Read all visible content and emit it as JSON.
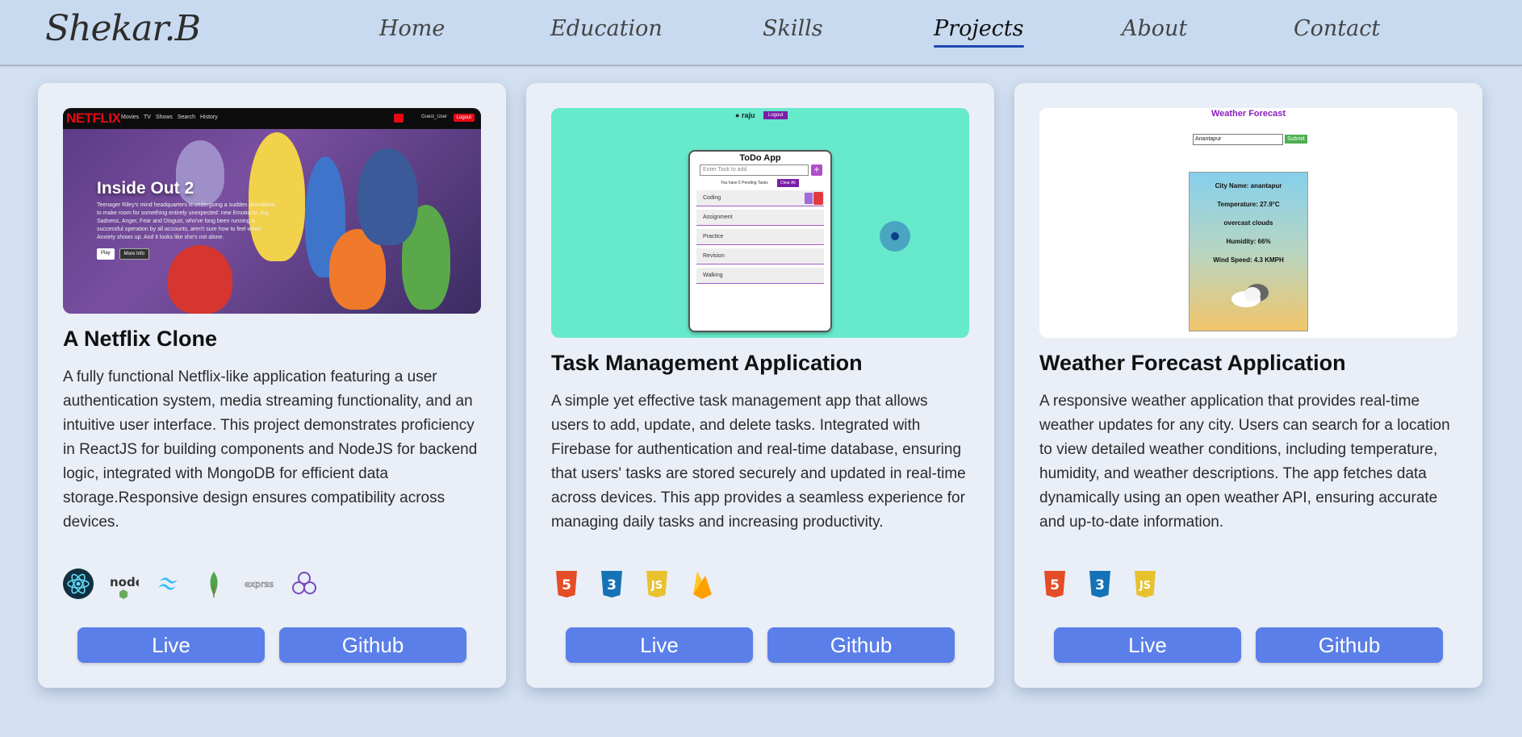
{
  "nav": {
    "brand": "Shekar.B",
    "links": [
      "Home",
      "Education",
      "Skills",
      "Projects",
      "About",
      "Contact"
    ],
    "active": "Projects"
  },
  "projects": [
    {
      "title": "A Netflix Clone",
      "description": "A fully functional Netflix-like application featuring a user authentication system, media streaming functionality, and an intuitive user interface. This project demonstrates proficiency in ReactJS for building components and NodeJS for backend logic, integrated with MongoDB for efficient data storage.Responsive design ensures compatibility across devices.",
      "tech_icons": [
        "react-icon",
        "nodejs-icon",
        "tailwind-icon",
        "mongodb-icon",
        "express-icon",
        "redux-icon"
      ],
      "live_label": "Live",
      "github_label": "Github",
      "screenshot": {
        "logo": "NETFLIX",
        "menu": "Movies TV Shows Search History",
        "user": "Guest_User",
        "logout": "Logout",
        "hero_title": "Inside Out 2",
        "hero_desc": "Teenager Riley's mind headquarters is undergoing a sudden demolition to make room for something entirely unexpected: new Emotions! Joy, Sadness, Anger, Fear and Disgust, who've long been running a successful operation by all accounts, aren't sure how to feel when Anxiety shows up. And it looks like she's not alone.",
        "play": "Play",
        "more_info": "More Info"
      }
    },
    {
      "title": "Task Management Application",
      "description": "A simple yet effective task management app that allows users to add, update, and delete tasks. Integrated with Firebase for authentication and real-time database, ensuring that users' tasks are stored securely and updated in real-time across devices. This app provides a seamless experience for managing daily tasks and increasing productivity.",
      "tech_icons": [
        "html5-icon",
        "css3-icon",
        "javascript-icon",
        "firebase-icon"
      ],
      "live_label": "Live",
      "github_label": "Github",
      "screenshot": {
        "user": "raju",
        "logout": "Logout",
        "app_title": "ToDo App",
        "input_placeholder": "Enter Task to add",
        "pending": "You have 5 Pending Tasks",
        "clear_all": "Clear All",
        "tasks": [
          "Coding",
          "Assignment",
          "Practice",
          "Revision",
          "Walking"
        ]
      }
    },
    {
      "title": "Weather Forecast Application",
      "description": "A responsive weather application that provides real-time weather updates for any city. Users can search for a location to view detailed weather conditions, including temperature, humidity, and weather descriptions. The app fetches data dynamically using an open weather API, ensuring accurate and up-to-date information.",
      "tech_icons": [
        "html5-icon",
        "css3-icon",
        "javascript-icon"
      ],
      "live_label": "Live",
      "github_label": "Github",
      "screenshot": {
        "app_title": "Weather Forecast",
        "input_value": "Anantapur",
        "submit": "Submit",
        "city": "City Name: anantapur",
        "temperature": "Temperature: 27.9°C",
        "condition": "overcast clouds",
        "humidity": "Humidity: 66%",
        "wind": "Wind Speed: 4.3 KMPH"
      }
    }
  ],
  "colors": {
    "accent_button": "#5b7fe8",
    "nav_active_underline": "#1f48b0",
    "page_bg": "#d3e0f2",
    "card_bg": "#e9eef7"
  }
}
